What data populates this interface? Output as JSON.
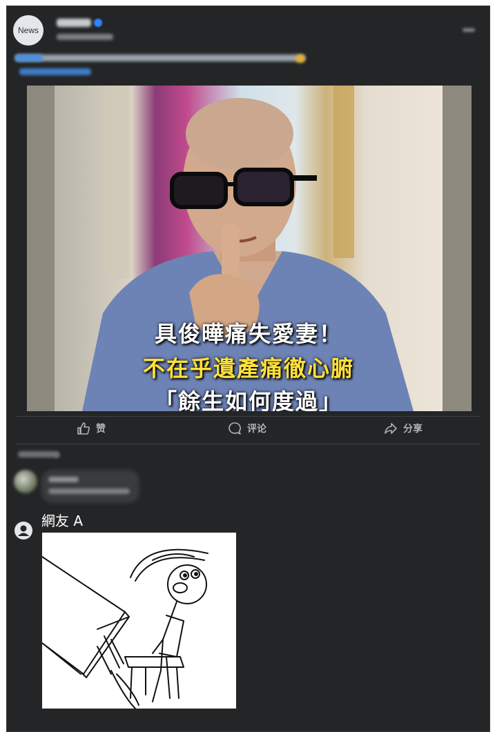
{
  "post": {
    "avatar_text": "News",
    "photo_caption": {
      "line1": "具俊曄痛失愛妻！",
      "line2": "不在乎遺產痛徹心腑",
      "line3": "「餘生如何度過」"
    }
  },
  "actions": {
    "like_label": "赞",
    "comment_label": "评论",
    "share_label": "分享"
  },
  "comments": [
    {
      "author": "網友 A"
    }
  ],
  "colors": {
    "card_bg": "#242526",
    "caption_yellow": "#ffe13a",
    "action_text": "#b0b3b8"
  }
}
